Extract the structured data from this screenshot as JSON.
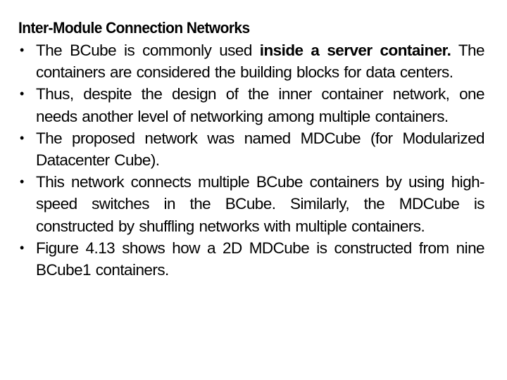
{
  "slide": {
    "title": "Inter-Module Connection Networks",
    "bullets": [
      {
        "pre": "The BCube is commonly used ",
        "bold": "inside a server container.",
        "post": " The containers are considered the building blocks for data centers."
      },
      {
        "pre": "Thus, despite the design of the inner container network, one needs another level of networking among multiple containers.",
        "bold": "",
        "post": ""
      },
      {
        "pre": "The proposed network was named MDCube (for Modularized Datacenter Cube).",
        "bold": "",
        "post": ""
      },
      {
        "pre": "This network connects multiple BCube containers by using high-speed switches in the BCube. Similarly, the MDCube is constructed by shuffling networks with multiple containers.",
        "bold": "",
        "post": ""
      },
      {
        "pre": "Figure 4.13 shows how a 2D MDCube is constructed from nine BCube1 containers.",
        "bold": "",
        "post": ""
      }
    ],
    "bullet_glyph": "•"
  }
}
